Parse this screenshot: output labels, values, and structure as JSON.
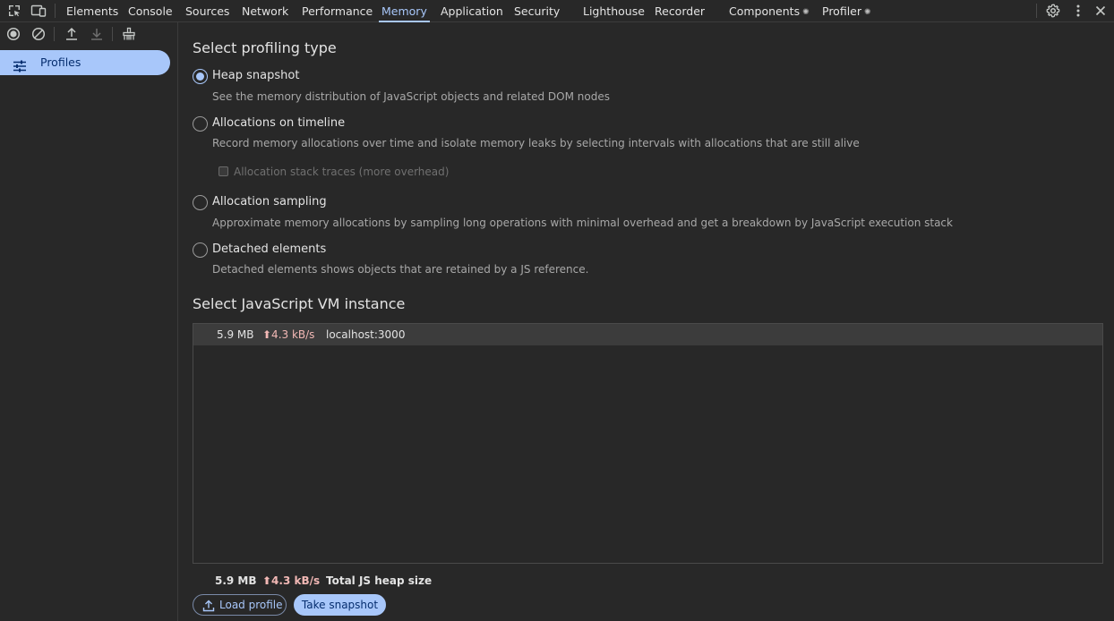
{
  "topbar": {
    "tabs": [
      {
        "label": "Elements"
      },
      {
        "label": "Console"
      },
      {
        "label": "Sources"
      },
      {
        "label": "Network"
      },
      {
        "label": "Performance"
      },
      {
        "label": "Memory"
      },
      {
        "label": "Application"
      },
      {
        "label": "Security"
      },
      {
        "label": "Lighthouse"
      },
      {
        "label": "Recorder"
      },
      {
        "label": "Components"
      },
      {
        "label": "Profiler"
      }
    ],
    "active_tab": "Memory",
    "icons": [
      "inspect-element-icon",
      "device-toolbar-icon",
      "settings-icon",
      "more-options-icon",
      "close-icon"
    ]
  },
  "sidebar": {
    "toolbar_icons": [
      "record-icon",
      "clear-icon",
      "upload-icon",
      "download-icon",
      "garbage-collect-icon"
    ],
    "items": [
      {
        "label": "Profiles",
        "icon": "profiles-sliders-icon",
        "selected": true
      }
    ]
  },
  "main": {
    "profiling_heading": "Select profiling type",
    "options": [
      {
        "title": "Heap snapshot",
        "desc": "See the memory distribution of JavaScript objects and related DOM nodes",
        "checked": true
      },
      {
        "title": "Allocations on timeline",
        "desc": "Record memory allocations over time and isolate memory leaks by selecting intervals with allocations that are still alive",
        "checked": false
      },
      {
        "title": "Allocation sampling",
        "desc": "Approximate memory allocations by sampling long operations with minimal overhead and get a breakdown by JavaScript execution stack",
        "checked": false
      },
      {
        "title": "Detached elements",
        "desc": "Detached elements shows objects that are retained by a JS reference.",
        "checked": false
      }
    ],
    "stack_traces_label": "Allocation stack traces (more overhead)",
    "vm_heading": "Select JavaScript VM instance",
    "vm_instances": [
      {
        "size": "5.9 MB",
        "rate": "⬆4.3 kB/s",
        "url": "localhost:3000"
      }
    ],
    "total": {
      "size": "5.9 MB",
      "rate": "⬆4.3 kB/s",
      "label": "Total JS heap size"
    },
    "load_button": "Load profile",
    "snapshot_button": "Take snapshot"
  },
  "colors": {
    "background": "#282828",
    "accent": "#a8c7fa",
    "rate": "#f2b8b5"
  }
}
